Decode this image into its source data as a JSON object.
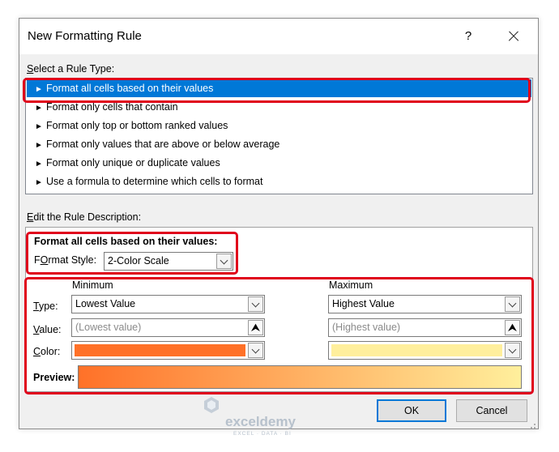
{
  "window": {
    "title": "New Formatting Rule",
    "help": "?"
  },
  "rule_type": {
    "label_u": "S",
    "label_rest": "elect a Rule Type:",
    "items": [
      {
        "label": "Format all cells based on their values"
      },
      {
        "label": "Format only cells that contain"
      },
      {
        "label": "Format only top or bottom ranked values"
      },
      {
        "label": "Format only values that are above or below average"
      },
      {
        "label": "Format only unique or duplicate values"
      },
      {
        "label": "Use a formula to determine which cells to format"
      }
    ],
    "selected_index": 0
  },
  "description": {
    "label_u": "E",
    "label_rest": "dit the Rule Description:",
    "heading": "Format all cells based on their values:",
    "format_style_label_u": "O",
    "format_style_label_pre": "F",
    "format_style_label_rest": "rmat Style:",
    "format_style_value": "2-Color Scale",
    "minimum": {
      "heading": "Minimum",
      "type_value": "Lowest Value",
      "value_placeholder": "(Lowest value)",
      "color": "#ff7128"
    },
    "maximum": {
      "heading": "Maximum",
      "type_value": "Highest Value",
      "value_placeholder": "(Highest value)",
      "color": "#ffef9c"
    },
    "type_label_pre": "",
    "type_label_u": "T",
    "type_label_rest": "ype:",
    "value_label_u": "V",
    "value_label_rest": "alue:",
    "color_label_u": "C",
    "color_label_rest": "olor:",
    "preview_label": "Preview:"
  },
  "buttons": {
    "ok": "OK",
    "cancel": "Cancel"
  },
  "watermark": {
    "name": "exceldemy",
    "tagline": "EXCEL · DATA · BI"
  },
  "icons": {
    "rule_bullet": "triangle-right-icon",
    "pick_cell": "upload-arrow-icon",
    "dropdown": "chevron-down-icon",
    "close": "close-icon"
  },
  "accent_colors": {
    "selection": "#0078d7",
    "highlight_frame": "#e0001b"
  }
}
